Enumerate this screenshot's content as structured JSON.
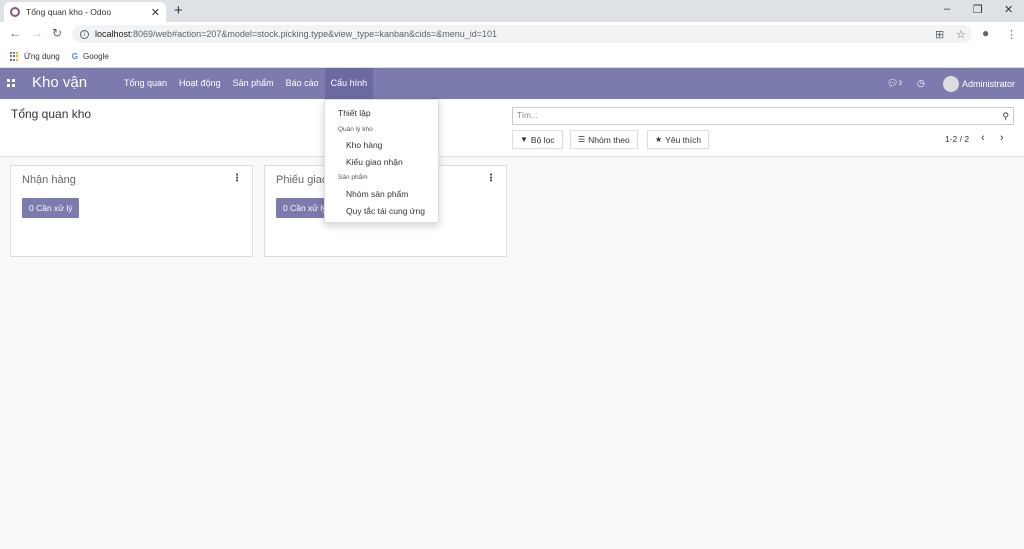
{
  "browser": {
    "tab_title": "Tổng quan kho - Odoo",
    "tab_close": "✕",
    "new_tab": "+",
    "url_host": "localhost",
    "url_rest": ":8069/web#action=207&model=stock.picking.type&view_type=kanban&cids=&menu_id=101",
    "bookmarks": [
      {
        "label": "Ứng dụng"
      },
      {
        "label": "Google"
      }
    ]
  },
  "odoo_nav": {
    "brand": "Kho vận",
    "menu": [
      {
        "label": "Tổng quan"
      },
      {
        "label": "Hoạt động"
      },
      {
        "label": "Sản phẩm"
      },
      {
        "label": "Báo cáo"
      },
      {
        "label": "Cấu hình"
      }
    ],
    "active_menu": "Cấu hình",
    "chat_count": "3",
    "user": "Administrator"
  },
  "control_panel": {
    "title": "Tổng quan kho",
    "search_placeholder": "Tìm...",
    "filter_label": "Bộ lọc",
    "groupby_label": "Nhóm theo",
    "favorites_label": "Yêu thích",
    "pager": "1-2 / 2"
  },
  "kanban": {
    "cards": [
      {
        "title": "Nhận hàng",
        "button": "0 Cần xử lý"
      },
      {
        "title": "Phiếu giao",
        "button": "0 Cần xử lý"
      }
    ]
  },
  "config_dropdown": {
    "settings": "Thiết lập",
    "section_warehouse": "Quản lý kho",
    "warehouses": "Kho hàng",
    "operation_types": "Kiểu giao nhận",
    "section_products": "Sản phẩm",
    "product_categories": "Nhóm sản phẩm",
    "replenishment_rules": "Quy tắc tái cung ứng"
  },
  "colors": {
    "odoo_purple": "#7c7bad",
    "active_menu_bg": "#6b6aa3"
  }
}
